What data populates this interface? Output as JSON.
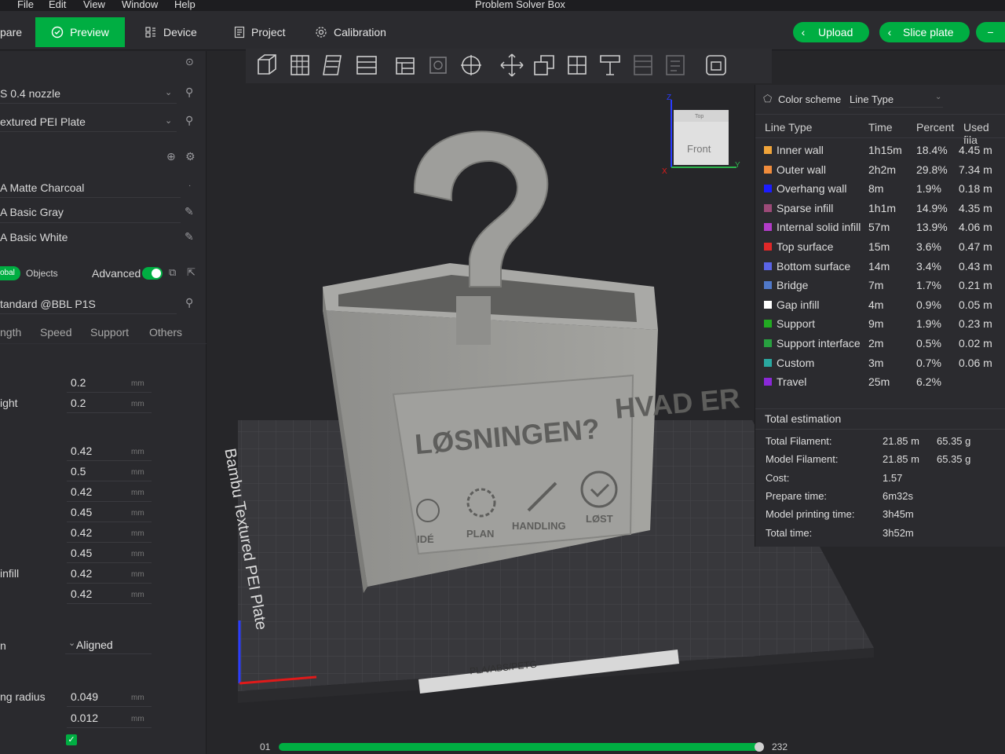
{
  "menu": [
    "File",
    "Edit",
    "View",
    "Window",
    "Help"
  ],
  "window_title": "Problem Solver Box",
  "tabs": {
    "prepare": "pare",
    "preview": "Preview",
    "device": "Device",
    "project": "Project",
    "calibration": "Calibration"
  },
  "actions": {
    "upload": "Upload",
    "slice": "Slice plate"
  },
  "left": {
    "nozzle": "S 0.4 nozzle",
    "plate": "extured PEI Plate",
    "filaments": [
      "A Matte Charcoal",
      "A Basic Gray",
      "A Basic White"
    ],
    "toggle_global": "obal",
    "toggle_objects": "Objects",
    "advanced": "Advanced",
    "process": "tandard @BBL P1S",
    "process_tabs": [
      "ngth",
      "Speed",
      "Support",
      "Others"
    ],
    "labels": {
      "r2": "ight",
      "r8": "infill",
      "aligned_label": "n",
      "radius": "ng radius"
    },
    "values": [
      "0.2",
      "0.2",
      "0.42",
      "0.5",
      "0.42",
      "0.45",
      "0.42",
      "0.45",
      "0.42",
      "0.42"
    ],
    "unit": "mm",
    "aligned": "Aligned",
    "radius_values": [
      "0.049",
      "0.012"
    ]
  },
  "viewcube": {
    "top": "Top",
    "front": "Front",
    "x": "X",
    "y": "Y",
    "z": "Z"
  },
  "model": {
    "line1": "HVAD ER",
    "line2": "LØSNINGEN?",
    "icons": [
      "IDÉ",
      "PLAN",
      "HANDLING",
      "LØST"
    ]
  },
  "bed": {
    "plate_name": "Bambu Textured PEI Plate",
    "materials": "PLA/ABS/PETG"
  },
  "legend": {
    "scheme_label": "Color scheme",
    "scheme_value": "Line Type",
    "headers": [
      "Line Type",
      "Time",
      "Percent",
      "Used fila"
    ],
    "rows": [
      {
        "name": "Inner wall",
        "time": "1h15m",
        "percent": "18.4%",
        "used": "4.45 m",
        "color": "#f0a43a"
      },
      {
        "name": "Outer wall",
        "time": "2h2m",
        "percent": "29.8%",
        "used": "7.34 m",
        "color": "#f08c3c"
      },
      {
        "name": "Overhang wall",
        "time": "8m",
        "percent": "1.9%",
        "used": "0.18 m",
        "color": "#1c1cff"
      },
      {
        "name": "Sparse infill",
        "time": "1h1m",
        "percent": "14.9%",
        "used": "4.35 m",
        "color": "#9c4a78"
      },
      {
        "name": "Internal solid infill",
        "time": "57m",
        "percent": "13.9%",
        "used": "4.06 m",
        "color": "#b23cc8"
      },
      {
        "name": "Top surface",
        "time": "15m",
        "percent": "3.6%",
        "used": "0.47 m",
        "color": "#e02828"
      },
      {
        "name": "Bottom surface",
        "time": "14m",
        "percent": "3.4%",
        "used": "0.43 m",
        "color": "#5a64e6"
      },
      {
        "name": "Bridge",
        "time": "7m",
        "percent": "1.7%",
        "used": "0.21 m",
        "color": "#5078c8"
      },
      {
        "name": "Gap infill",
        "time": "4m",
        "percent": "0.9%",
        "used": "0.05 m",
        "color": "#ffffff"
      },
      {
        "name": "Support",
        "time": "9m",
        "percent": "1.9%",
        "used": "0.23 m",
        "color": "#22aa22"
      },
      {
        "name": "Support interface",
        "time": "2m",
        "percent": "0.5%",
        "used": "0.02 m",
        "color": "#28a040"
      },
      {
        "name": "Custom",
        "time": "3m",
        "percent": "0.7%",
        "used": "0.06 m",
        "color": "#2aa8a0"
      },
      {
        "name": "Travel",
        "time": "25m",
        "percent": "6.2%",
        "used": "",
        "color": "#8a28d8"
      }
    ],
    "total_title": "Total estimation",
    "totals": [
      {
        "label": "Total Filament:",
        "v1": "21.85 m",
        "v2": "65.35 g"
      },
      {
        "label": "Model Filament:",
        "v1": "21.85 m",
        "v2": "65.35 g"
      },
      {
        "label": "Cost:",
        "v1": "1.57",
        "v2": ""
      },
      {
        "label": "Prepare time:",
        "v1": "6m32s",
        "v2": ""
      },
      {
        "label": "Model printing time:",
        "v1": "3h45m",
        "v2": ""
      },
      {
        "label": "Total time:",
        "v1": "3h52m",
        "v2": ""
      }
    ]
  },
  "layer_slider": {
    "min": "01",
    "max": "232"
  }
}
